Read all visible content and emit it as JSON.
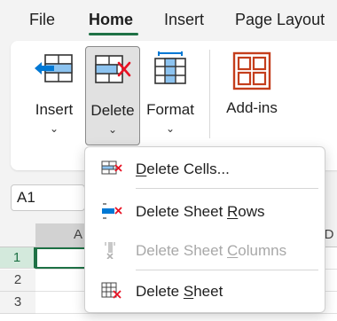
{
  "tabs": [
    {
      "label": "File",
      "active": false
    },
    {
      "label": "Home",
      "active": true
    },
    {
      "label": "Insert",
      "active": false
    },
    {
      "label": "Page Layout",
      "active": false
    }
  ],
  "ribbon": {
    "buttons": [
      {
        "label": "Insert",
        "icon": "insert-cells-icon",
        "has_dropdown": true
      },
      {
        "label": "Delete",
        "icon": "delete-cells-icon",
        "has_dropdown": true,
        "pressed": true
      },
      {
        "label": "Format",
        "icon": "format-cells-icon",
        "has_dropdown": true
      },
      {
        "label": "Add-ins",
        "icon": "add-ins-icon",
        "has_dropdown": false
      }
    ]
  },
  "namebox": {
    "value": "A1"
  },
  "grid": {
    "columns": [
      "A",
      "D"
    ],
    "rows": [
      "1",
      "2",
      "3"
    ]
  },
  "delete_menu": {
    "items": [
      {
        "pre": "",
        "u": "D",
        "post": "elete Cells...",
        "icon": "delete-cells-menu-icon",
        "enabled": true
      },
      {
        "pre": "Delete Sheet ",
        "u": "R",
        "post": "ows",
        "icon": "delete-sheet-rows-icon",
        "enabled": true
      },
      {
        "pre": "Delete Sheet ",
        "u": "C",
        "post": "olumns",
        "icon": "delete-sheet-columns-icon",
        "enabled": false
      },
      {
        "pre": "Delete ",
        "u": "S",
        "post": "heet",
        "icon": "delete-sheet-icon",
        "enabled": true
      }
    ]
  },
  "colors": {
    "accent": "#1e7145",
    "delete_red": "#e81123",
    "icon_blue": "#0078d4",
    "addins_orange": "#c43e1c"
  }
}
